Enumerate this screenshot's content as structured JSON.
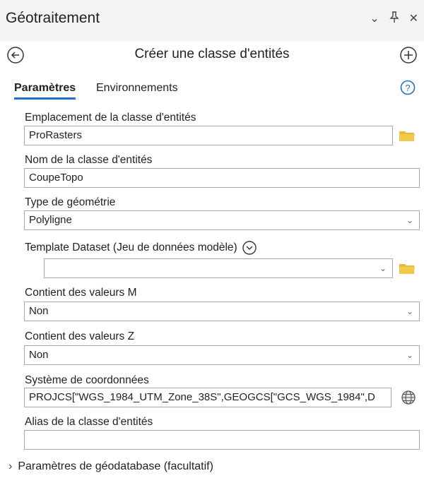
{
  "panel": {
    "title": "Géotraitement",
    "controls": {
      "dropdown": "⌄",
      "pin": "📌",
      "close": "✕"
    }
  },
  "tool": {
    "title": "Créer une classe d'entités"
  },
  "tabs": {
    "parameters": "Paramètres",
    "environments": "Environnements"
  },
  "params": {
    "location": {
      "label": "Emplacement de la classe d'entités",
      "value": "ProRasters"
    },
    "name": {
      "label": "Nom de la classe d'entités",
      "value": "CoupeTopo"
    },
    "geometry": {
      "label": "Type de géométrie",
      "value": "Polyligne"
    },
    "template": {
      "label": "Template Dataset (Jeu de données modèle)",
      "value": ""
    },
    "has_m": {
      "label": "Contient des valeurs M",
      "value": "Non"
    },
    "has_z": {
      "label": "Contient des valeurs Z",
      "value": "Non"
    },
    "coord": {
      "label": "Système de coordonnées",
      "value": "PROJCS[\"WGS_1984_UTM_Zone_38S\",GEOGCS[\"GCS_WGS_1984\",D"
    },
    "alias": {
      "label": "Alias de la classe d'entités",
      "value": ""
    }
  },
  "footer": {
    "section": "Paramètres de géodatabase (facultatif)"
  },
  "colors": {
    "accent": "#1e6fd4",
    "folder": "#e8b93c"
  }
}
